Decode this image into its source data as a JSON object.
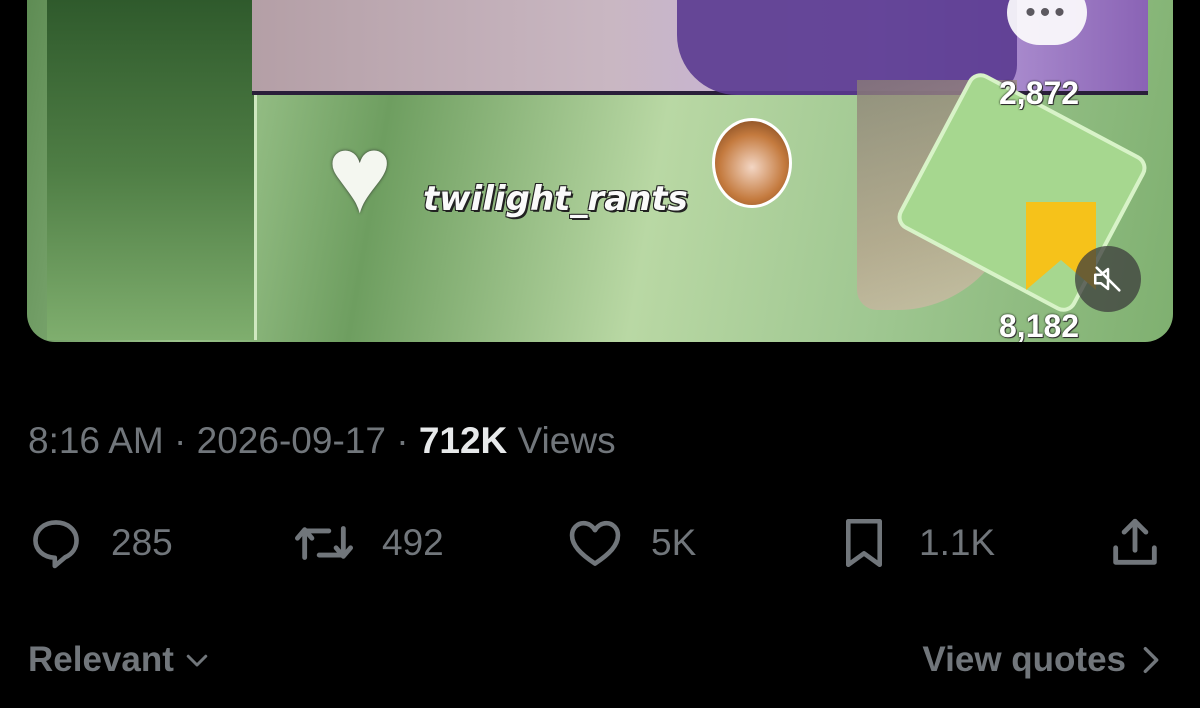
{
  "media": {
    "watermark": "twilight_rants",
    "overlay_comments_count": "2,872",
    "overlay_saves_count": "8,182",
    "bookmark_color": "#f6c21a"
  },
  "meta": {
    "time": "8:16 AM",
    "separator": "·",
    "date": "2026-09-17",
    "views_count": "712K",
    "views_label": "Views"
  },
  "actions": {
    "replies": "285",
    "reposts": "492",
    "likes": "5K",
    "bookmarks": "1.1K"
  },
  "footer": {
    "sort_label": "Relevant",
    "view_quotes_label": "View quotes"
  },
  "colors": {
    "background": "#000000",
    "muted_text": "#71767b",
    "primary_text": "#e7e9ea"
  }
}
